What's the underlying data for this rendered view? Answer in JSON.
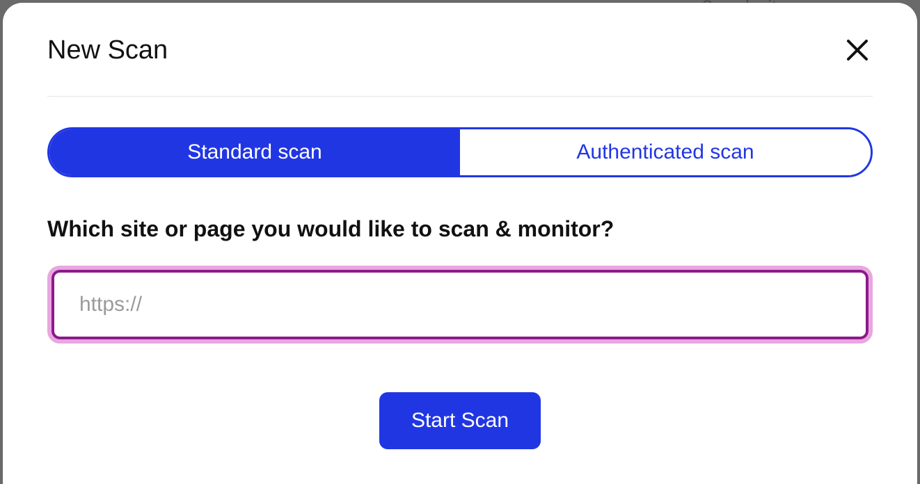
{
  "background_hint": "Search sites",
  "modal": {
    "title": "New Scan",
    "tabs": {
      "standard": "Standard scan",
      "authenticated": "Authenticated scan"
    },
    "prompt": "Which site or page you would like to scan & monitor?",
    "url_input": {
      "placeholder": "https://",
      "value": ""
    },
    "start_button": "Start Scan"
  }
}
